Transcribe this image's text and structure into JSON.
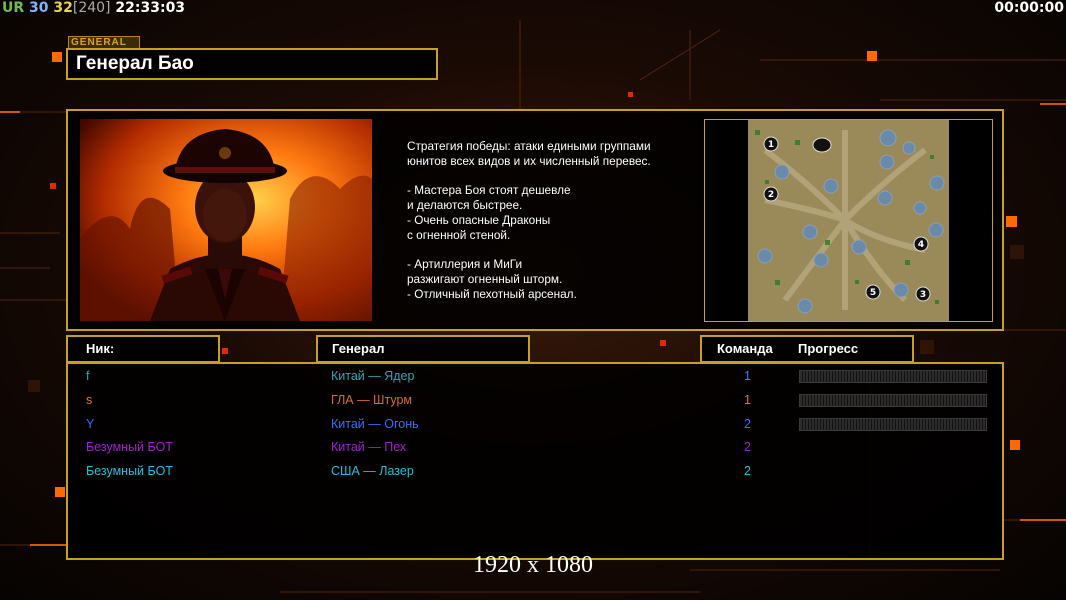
{
  "hud": {
    "ur": "UR",
    "n1": "30",
    "n2": "32",
    "bracket": "[240]",
    "clock": "22:33:03",
    "game_time": "00:00:00"
  },
  "general": {
    "tag": "GENERAL",
    "name": "Генерал Бао"
  },
  "strategy_lines": [
    "Стратегия победы: атаки едиными группами",
    "юнитов всех видов и их численный перевес.",
    "",
    "- Мастера Боя стоят дешевле",
    "и делаются быстрее.",
    "- Очень опасные Драконы",
    "с огненной стеной.",
    "",
    "- Артиллерия и МиГи",
    "разжигают огненный шторм.",
    "- Отличный пехотный арсенал."
  ],
  "map": {
    "slots": [
      "1",
      "2",
      "3",
      "4",
      "5"
    ]
  },
  "headers": {
    "nick": "Ник:",
    "general": "Генерал",
    "team": "Команда",
    "progress": "Прогресс"
  },
  "players": [
    {
      "nick": "f",
      "general": "Китай — Ядер",
      "team": "1",
      "color_nick": "#2aa7b8",
      "color_general": "#2aa7b8",
      "color_team": "#3a7bff",
      "progress": 0
    },
    {
      "nick": "s",
      "general": "ГЛА — Штурм",
      "team": "1",
      "color_nick": "#e07a30",
      "color_general": "#d96a30",
      "color_team": "#e07a30",
      "progress": 0
    },
    {
      "nick": "Y",
      "general": "Китай — Огонь",
      "team": "2",
      "color_nick": "#3a6cff",
      "color_general": "#3a6cff",
      "color_team": "#3a6cff",
      "progress": 0
    },
    {
      "nick": "Безумный БОТ",
      "general": "Китай — Пех",
      "team": "2",
      "color_nick": "#a020d0",
      "color_general": "#a020d0",
      "color_team": "#a020d0",
      "progress": null
    },
    {
      "nick": "Безумный БОТ",
      "general": "США — Лазер",
      "team": "2",
      "color_nick": "#1ec0e0",
      "color_general": "#1ec0e0",
      "color_team": "#1ec0e0",
      "progress": null
    }
  ],
  "resolution": "1920 x 1080",
  "colors": {
    "frame": "#c8a020",
    "background": "#0a0503"
  }
}
